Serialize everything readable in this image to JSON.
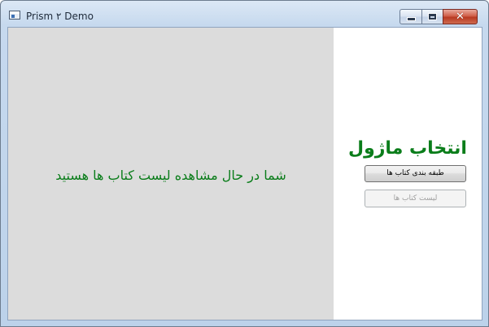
{
  "window": {
    "title": "Prism ۲ Demo",
    "icon": "app-window-icon",
    "controls": {
      "minimize_icon": "minimize-icon",
      "maximize_icon": "maximize-icon",
      "close_icon": "close-icon",
      "close_glyph": "✕"
    }
  },
  "content_region": {
    "message": "شما در حال مشاهده لیست کتاب ها هستید",
    "background": "#dcdcdc",
    "text_color": "#0a7d1a"
  },
  "navigation_region": {
    "title": "انتخاب ماژول",
    "buttons": [
      {
        "label": "طبقه بندی کتاب ها",
        "enabled": true
      },
      {
        "label": "لیست کتاب ها",
        "enabled": false
      }
    ],
    "title_color": "#0a7d1a"
  }
}
